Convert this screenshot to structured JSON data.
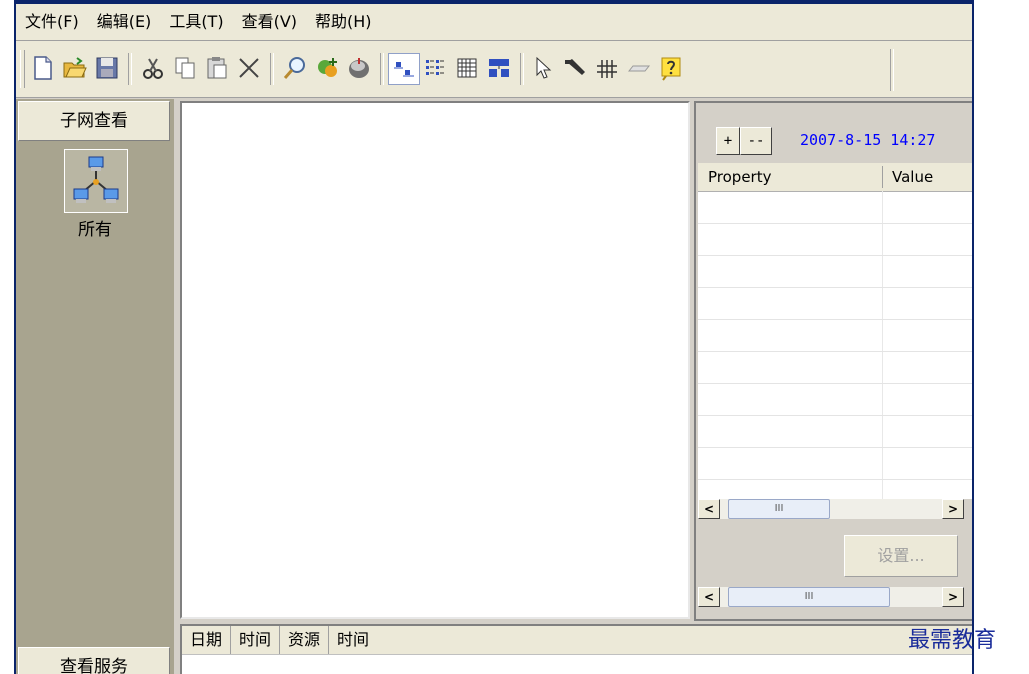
{
  "menu": [
    "文件(F)",
    "编辑(E)",
    "工具(T)",
    "查看(V)",
    "帮助(H)"
  ],
  "toolbar_icons": [
    "new-file-icon",
    "open-folder-icon",
    "save-icon",
    "cut-icon",
    "copy-icon",
    "paste-icon",
    "delete-icon",
    "find-icon",
    "add-resource-icon",
    "ping-icon",
    "large-icons-view-icon",
    "small-icons-view-icon",
    "list-view-icon",
    "detail-view-icon",
    "pointer-icon",
    "link-tool-icon",
    "grid-tool-icon",
    "eraser-icon",
    "help-icon"
  ],
  "left_panel": {
    "header": "子网查看",
    "item_label": "所有",
    "footer": "查看服务"
  },
  "right_panel": {
    "plus": "+",
    "minus": "--",
    "datetime": "2007-8-15 14:27",
    "columns": [
      "Property",
      "Value"
    ],
    "scroll_thumb": "III",
    "settings_button": "设置..."
  },
  "log_columns": [
    "日期",
    "时间",
    "资源",
    "时间"
  ],
  "watermark": "最需教育"
}
